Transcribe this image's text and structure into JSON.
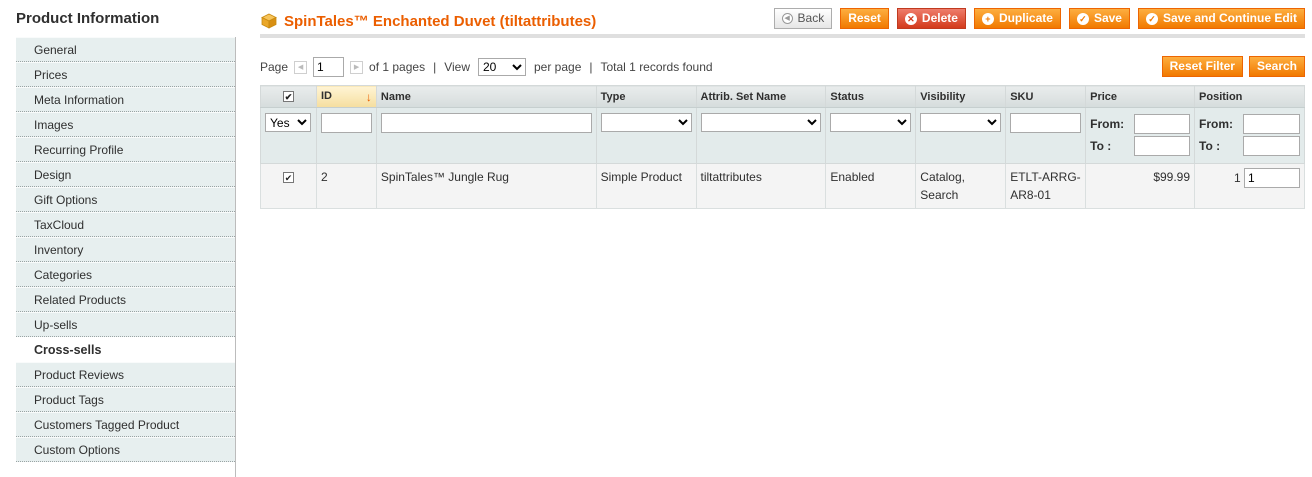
{
  "sidebar": {
    "title": "Product Information",
    "items": [
      {
        "label": "General"
      },
      {
        "label": "Prices"
      },
      {
        "label": "Meta Information"
      },
      {
        "label": "Images"
      },
      {
        "label": "Recurring Profile"
      },
      {
        "label": "Design"
      },
      {
        "label": "Gift Options"
      },
      {
        "label": "TaxCloud"
      },
      {
        "label": "Inventory"
      },
      {
        "label": "Categories"
      },
      {
        "label": "Related Products"
      },
      {
        "label": "Up-sells"
      },
      {
        "label": "Cross-sells"
      },
      {
        "label": "Product Reviews"
      },
      {
        "label": "Product Tags"
      },
      {
        "label": "Customers Tagged Product"
      },
      {
        "label": "Custom Options"
      }
    ],
    "active_index": 12
  },
  "header": {
    "title": "SpinTales™ Enchanted Duvet (tiltattributes)",
    "icon": "box-icon",
    "buttons": {
      "back": "Back",
      "reset": "Reset",
      "delete": "Delete",
      "duplicate": "Duplicate",
      "save": "Save",
      "save_continue": "Save and Continue Edit"
    }
  },
  "pager": {
    "page_label": "Page",
    "page_value": "1",
    "of_pages": "of 1 pages",
    "sep": "|",
    "view_label": "View",
    "per_page_value": "20",
    "per_page_label": "per page",
    "total": "Total 1 records found"
  },
  "filter_buttons": {
    "reset_filter": "Reset Filter",
    "search": "Search"
  },
  "grid": {
    "columns": {
      "id": "ID",
      "name": "Name",
      "type": "Type",
      "attrib_set": "Attrib. Set Name",
      "status": "Status",
      "visibility": "Visibility",
      "sku": "SKU",
      "price": "Price",
      "position": "Position"
    },
    "filters": {
      "in_products": "Yes",
      "from": "From:",
      "to": "To :"
    },
    "rows": [
      {
        "checked": true,
        "id": "2",
        "name": "SpinTales™ Jungle Rug",
        "type": "Simple Product",
        "attrib_set": "tiltattributes",
        "status": "Enabled",
        "visibility": "Catalog, Search",
        "sku": "ETLT-ARRG-AR8-01",
        "price": "$99.99",
        "position": "1",
        "position_input": "1"
      }
    ]
  },
  "colors": {
    "accent": "#eb5e00",
    "button_orange": "#f17900",
    "button_red": "#d33a1c",
    "tab_bg": "#e7efef",
    "filter_bg": "#e3ebeb"
  }
}
